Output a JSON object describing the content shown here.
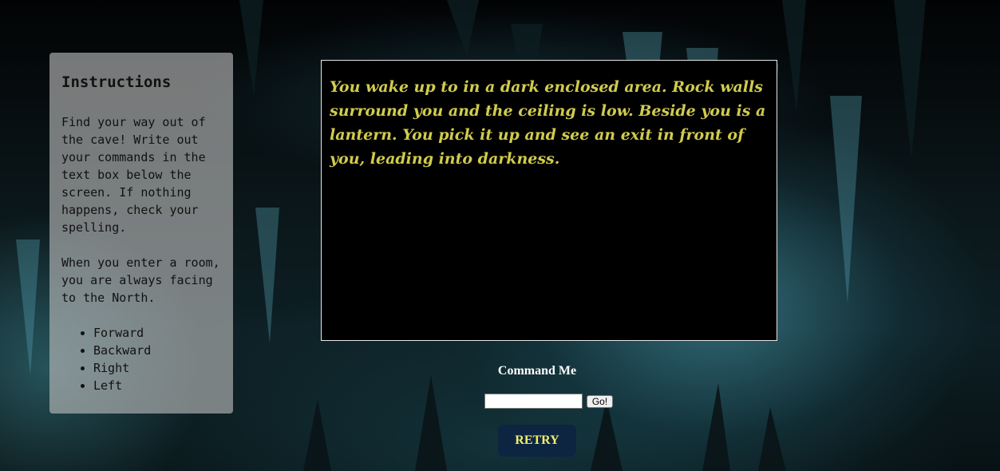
{
  "instructions": {
    "title": "Instructions",
    "paragraph1": "Find your way out of the cave! Write out your commands in the text box below the screen. If nothing happens, check your spelling.",
    "paragraph2": "When you enter a room, you are always facing to the North.",
    "commands": [
      "Forward",
      "Backward",
      "Right",
      "Left"
    ]
  },
  "screen": {
    "text": "You wake up to in a dark enclosed area. Rock walls surround you and the ceiling is low. Beside you is a lantern. You pick it up and see an exit in front of you, leading into darkness."
  },
  "command": {
    "label": "Command Me",
    "input_value": "",
    "go_label": "Go!"
  },
  "retry_label": "RETRY",
  "colors": {
    "screen_text": "#d1cc4e",
    "retry_bg": "#0d2540",
    "retry_text": "#f5ee6a"
  }
}
